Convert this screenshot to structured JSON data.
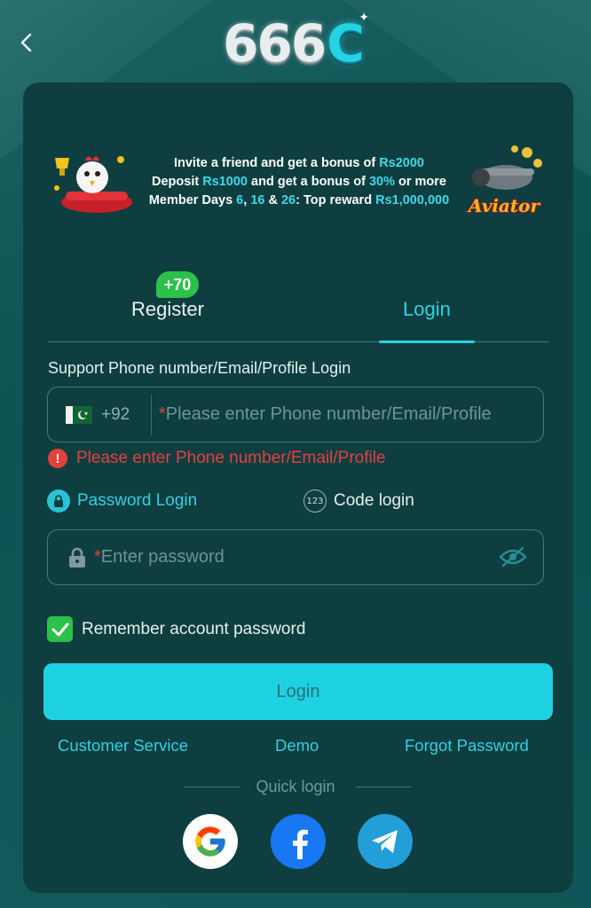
{
  "header": {
    "back_icon": "chevron-left-icon",
    "logo_digits": "666",
    "logo_letter": "C"
  },
  "banner": {
    "line1_prefix": "Invite a friend and get a bonus of ",
    "line1_amount": "Rs2000",
    "line2_prefix": "Deposit ",
    "line2_amount": "Rs1000",
    "line2_mid": " and get a bonus of ",
    "line2_pct": "30%",
    "line2_suffix": " or more",
    "line3_prefix": "Member Days ",
    "line3_d1": "6",
    "line3_sep1": ", ",
    "line3_d2": "16",
    "line3_sep2": " & ",
    "line3_d3": "26",
    "line3_mid": ": Top reward ",
    "line3_reward": "Rs1,000,000",
    "right_game_label": "Aviator"
  },
  "tabs": {
    "register_label": "Register",
    "register_badge": "+70",
    "login_label": "Login",
    "active": "login"
  },
  "form": {
    "account_label": "Support Phone number/Email/Profile Login",
    "country_code": "+92",
    "required_mark": "*",
    "account_placeholder": "Please enter Phone number/Email/Profile",
    "error_text": "Please enter Phone number/Email/Profile",
    "error_icon": "!",
    "mode_password_label": "Password Login",
    "mode_code_label": "Code login",
    "mode_code_icon": "123",
    "password_placeholder": "Enter password",
    "remember_label": "Remember account password",
    "remember_checked": true,
    "login_button": "Login"
  },
  "links": {
    "customer_service": "Customer Service",
    "demo": "Demo",
    "forgot_password": "Forgot Password"
  },
  "quick_login": {
    "title": "Quick login",
    "providers": [
      "google",
      "facebook",
      "telegram"
    ]
  },
  "colors": {
    "accent": "#1ed1e0",
    "error": "#e4403e",
    "success": "#2cc14a",
    "card": "#0e3e40"
  }
}
